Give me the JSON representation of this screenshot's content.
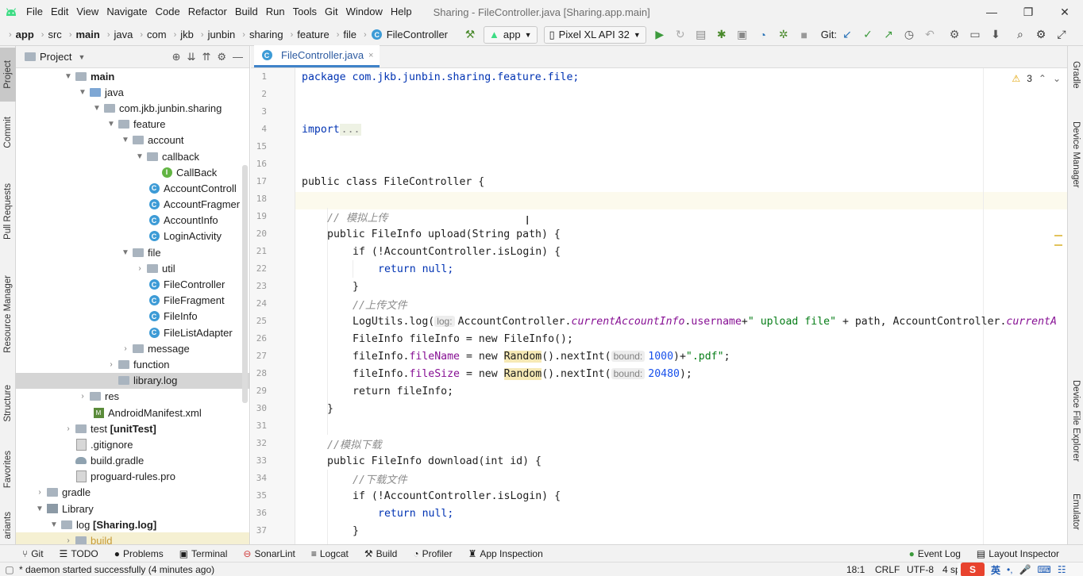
{
  "menubar": {
    "items": [
      "File",
      "Edit",
      "View",
      "Navigate",
      "Code",
      "Refactor",
      "Build",
      "Run",
      "Tools",
      "Git",
      "Window",
      "Help"
    ],
    "title": "Sharing - FileController.java [Sharing.app.main]",
    "minimize": "—",
    "maximize": "❐",
    "close": "✕"
  },
  "navbar": {
    "crumbs": [
      "app",
      "src",
      "main",
      "java",
      "com",
      "jkb",
      "junbin",
      "sharing",
      "feature",
      "file",
      "FileController"
    ],
    "run_config": "app",
    "device": "Pixel XL API 32",
    "git_label": "Git:"
  },
  "left_tabs": [
    "Project",
    "Commit",
    "Pull Requests",
    "Resource Manager",
    "Structure",
    "Favorites",
    "ariants"
  ],
  "right_tabs": [
    "Gradle",
    "Device Manager",
    "Device File Explorer",
    "Emulator"
  ],
  "project": {
    "header": "Project",
    "tree": [
      {
        "label": "main",
        "bold": true
      },
      {
        "label": "java"
      },
      {
        "label": "com.jkb.junbin.sharing"
      },
      {
        "label": "feature"
      },
      {
        "label": "account"
      },
      {
        "label": "callback"
      },
      {
        "label": "CallBack"
      },
      {
        "label": "AccountControll"
      },
      {
        "label": "AccountFragmer"
      },
      {
        "label": "AccountInfo"
      },
      {
        "label": "LoginActivity"
      },
      {
        "label": "file"
      },
      {
        "label": "util"
      },
      {
        "label": "FileController"
      },
      {
        "label": "FileFragment"
      },
      {
        "label": "FileInfo"
      },
      {
        "label": "FileListAdapter"
      },
      {
        "label": "message"
      },
      {
        "label": "function"
      },
      {
        "label": "library.log"
      },
      {
        "label": "res"
      },
      {
        "label": "AndroidManifest.xml"
      },
      {
        "label": "test",
        "suffix": "[unitTest]"
      },
      {
        "label": ".gitignore"
      },
      {
        "label": "build.gradle"
      },
      {
        "label": "proguard-rules.pro"
      },
      {
        "label": "gradle"
      },
      {
        "label": "Library"
      },
      {
        "label": "log",
        "suffix": "[Sharing.log]"
      },
      {
        "label": "build"
      }
    ]
  },
  "editor": {
    "tab_label": "FileController.java",
    "warnings": "3",
    "line_numbers": [
      "1",
      "2",
      "3",
      "4",
      "15",
      "16",
      "17",
      "18",
      "19",
      "20",
      "21",
      "22",
      "23",
      "24",
      "25",
      "26",
      "27",
      "28",
      "29",
      "30",
      "31",
      "32",
      "33",
      "34",
      "35",
      "36",
      "37"
    ],
    "code": {
      "pkg": "package com.jkb.junbin.sharing.feature.file;",
      "import_kw": "import",
      "import_fold": "...",
      "class_decl": "public class FileController {",
      "c_upload": "// 模拟上传",
      "upload_sig": "public FileInfo upload(String path) {",
      "if_login": "if (!AccountController.isLogin) {",
      "ret_null": "return null;",
      "brace": "}",
      "c_upload_file": "//上传文件",
      "log_call": "LogUtils.log(",
      "hint_log": "log:",
      "log_args_a": "AccountController.",
      "log_args_b": "currentAccountInfo",
      "log_args_c": ".",
      "log_args_d": "username",
      "log_args_e": "+",
      "log_args_f": "\" upload file\"",
      "log_args_g": " + path, AccountController.",
      "log_args_h": "currentA",
      "new_info": "FileInfo fileInfo = new FileInfo();",
      "fname_a": "fileInfo.",
      "fname_b": "fileName",
      "fname_c": " = new ",
      "random": "Random",
      "fname_d": "().nextInt(",
      "hint_bound": "bound:",
      "n1000": "1000",
      "fname_e": ")+",
      "pdf": "\".pdf\"",
      "semi": ";",
      "fsize_b": "fileSize",
      "n20480": "20480",
      "close_paren": ");",
      "ret_info": "return fileInfo;",
      "c_download": "//模拟下载",
      "download_sig": "public FileInfo download(int id) {",
      "c_download_file": "//下载文件"
    }
  },
  "bottom_tools": [
    "Git",
    "TODO",
    "Problems",
    "Terminal",
    "SonarLint",
    "Logcat",
    "Build",
    "Profiler",
    "App Inspection"
  ],
  "bottom_tools_right": [
    "Event Log",
    "Layout Inspector"
  ],
  "status": {
    "message": "* daemon started successfully (4 minutes ago)",
    "position": "18:1",
    "line_sep": "CRLF",
    "encoding": "UTF-8",
    "indent": "4 sp",
    "ime_logo": "S",
    "ime_lang": "英"
  },
  "colors": {
    "accent": "#4083c9",
    "keyword": "#0033b3",
    "string": "#067d17",
    "number": "#1750eb",
    "field": "#871094",
    "comment": "#8c8c8c"
  }
}
